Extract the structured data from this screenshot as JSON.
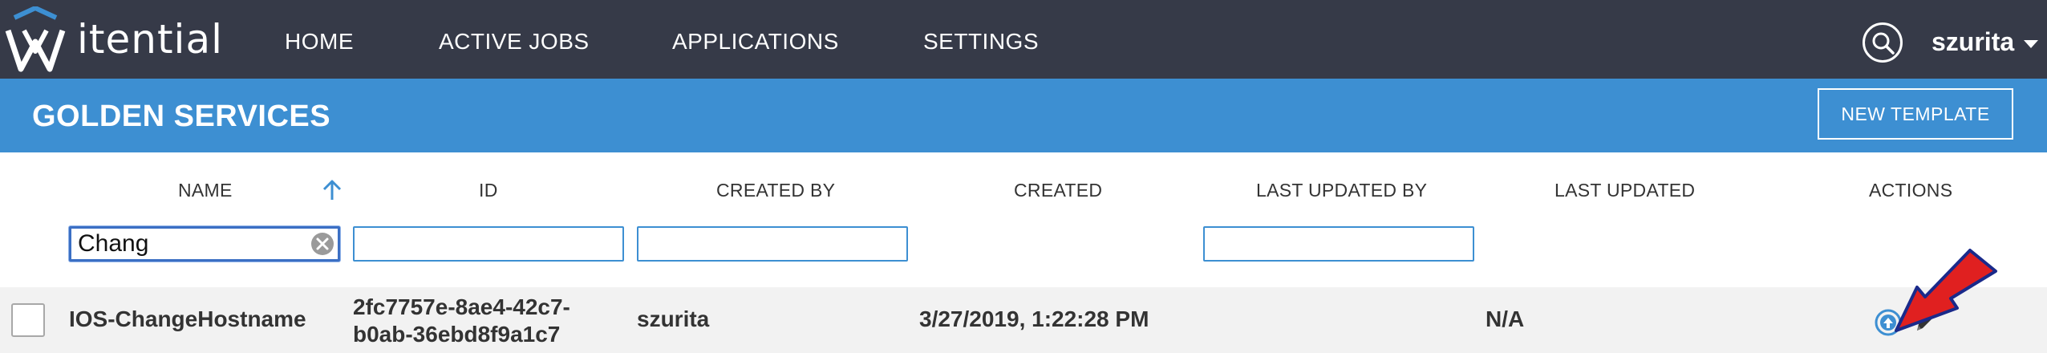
{
  "header": {
    "brand": "itential",
    "nav": [
      {
        "label": "HOME"
      },
      {
        "label": "ACTIVE JOBS"
      },
      {
        "label": "APPLICATIONS"
      },
      {
        "label": "SETTINGS"
      }
    ],
    "user": "szurita"
  },
  "page": {
    "title": "GOLDEN SERVICES",
    "new_template_label": "NEW TEMPLATE"
  },
  "table": {
    "columns": {
      "name": "NAME",
      "id": "ID",
      "created_by": "CREATED BY",
      "created": "CREATED",
      "last_updated_by": "LAST UPDATED BY",
      "last_updated": "LAST UPDATED",
      "actions": "ACTIONS"
    },
    "filters": {
      "name": "Chang",
      "id": "",
      "created_by": "",
      "last_updated_by": ""
    },
    "rows": [
      {
        "name": "IOS-ChangeHostname",
        "id_line1": "2fc7757e-8ae4-42c7-",
        "id_line2": "b0ab-36ebd8f9a1c7",
        "created_by": "szurita",
        "created": "3/27/2019, 1:22:28 PM",
        "last_updated": "N/A"
      }
    ]
  },
  "colors": {
    "navbar": "#363a48",
    "titlebar": "#3d8fd2",
    "accent": "#3d8fd2",
    "annotation_arrow": "#e02020"
  },
  "icons": {
    "logo": "itential-logo-icon",
    "search": "search-icon",
    "sort": "sort-ascending-icon",
    "clear": "clear-circle-icon",
    "upload": "upload-circle-icon",
    "edit": "pencil-icon"
  }
}
